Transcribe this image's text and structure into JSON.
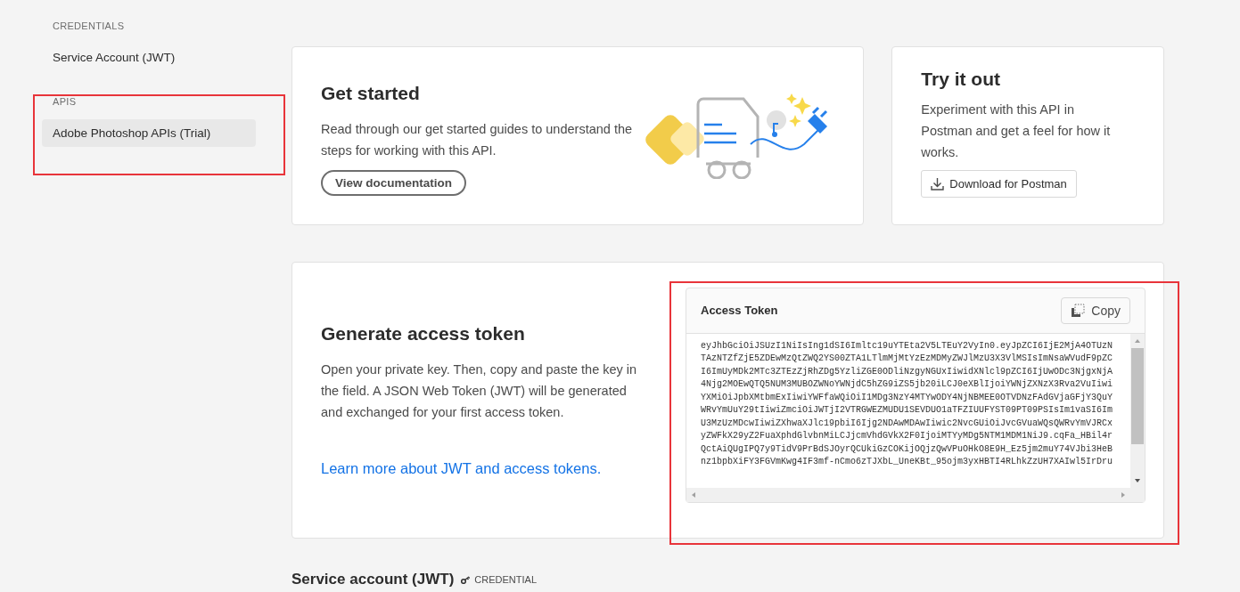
{
  "sidebar": {
    "sections": [
      {
        "heading": "CREDENTIALS",
        "items": [
          {
            "label": "Service Account (JWT)",
            "selected": false
          }
        ]
      },
      {
        "heading": "APIS",
        "items": [
          {
            "label": "Adobe Photoshop APIs (Trial)",
            "selected": true
          }
        ]
      }
    ]
  },
  "get_started": {
    "title": "Get started",
    "description": "Read through our get started guides to understand the steps for working with this API.",
    "button": "View documentation"
  },
  "try_it_out": {
    "title": "Try it out",
    "description": "Experiment with this API in Postman and get a feel for how it works.",
    "button": "Download for Postman"
  },
  "generate_token": {
    "title": "Generate access token",
    "description": "Open your private key. Then, copy and paste the key in the field. A JSON Web Token (JWT) will be generated and exchanged for your first access token.",
    "link": "Learn more about JWT and access tokens.",
    "token_panel": {
      "title": "Access Token",
      "copy_button": "Copy",
      "token_lines": [
        "eyJhbGciOiJSUzI1NiIsIng1dSI6Imltc19uYTEta2V5LTEuY2VyIn0.eyJpZCI6IjE2MjA4OTUzN",
        "TAzNTZfZjE5ZDEwMzQtZWQ2YS00ZTA1LTlmMjMtYzEzMDMyZWJlMzU3X3VlMSIsImNsaWVudF9pZC",
        "I6ImUyMDk2MTc3ZTEzZjRhZDg5YzliZGE0ODliNzgyNGUxIiwidXNlcl9pZCI6IjUwODc3NjgxNjA",
        "4Njg2MOEwQTQ5NUM3MUBOZWNoYWNjdC5hZG9iZS5jb20iLCJ0eXBlIjoiYWNjZXNzX3Rva2VuIiwi",
        "YXMiOiJpbXMtbmExIiwiYWFfaWQiOiI1MDg3NzY4MTYwODY4NjNBMEE0OTVDNzFAdGVjaGFjY3QuY",
        "WRvYmUuY29tIiwiZmciOiJWTjI2VTRGWEZMUDU1SEVDUO1aTFZIUUFYST09PT09PSIsIm1vaSI6Im",
        "U3MzUzMDcwIiwiZXhwaXJlc19pbiI6Ijg2NDAwMDAwIiwic2NvcGUiOiJvcGVuaWQsQWRvYmVJRCx",
        "yZWFkX29yZ2FuaXphdGlvbnMiLCJjcmVhdGVkX2F0IjoiMTYyMDg5NTM1MDM1NiJ9.cqFa_HBil4r",
        "QctAiQUgIPQ7y9TidV9PrBdSJOyrQCUkiGzCOKijOQjzQwVPuOHkO8E9H_Ez5jm2muY74VJbi3HeB",
        "nz1bpbXiFY3FGVmKwg4IF3mf-nCmo6zTJXbL_UneKBt_95ojm3yxHBTI4RLhkZzUH7XAIwl5IrDru"
      ]
    }
  },
  "section_heading": {
    "title": "Service account (JWT)",
    "tag": "CREDENTIAL"
  }
}
